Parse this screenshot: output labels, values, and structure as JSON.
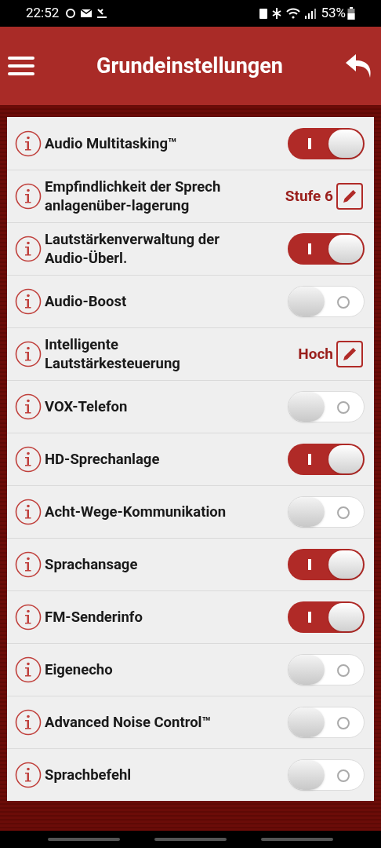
{
  "status_bar": {
    "time": "22:52",
    "battery": "53%"
  },
  "header": {
    "title": "Grundeinstellungen"
  },
  "rows": [
    {
      "kind": "toggle",
      "label": "Audio Multitasking™",
      "on": true
    },
    {
      "kind": "value",
      "label": "Empfindlichkeit der Sprech anlagenüber-lagerung",
      "value": "Stufe 6"
    },
    {
      "kind": "toggle",
      "label": "Lautstärkenverwaltung der Audio-Überl.",
      "on": true
    },
    {
      "kind": "toggle",
      "label": "Audio-Boost",
      "on": false
    },
    {
      "kind": "value",
      "label": "Intelligente Lautstärkesteuerung",
      "value": "Hoch"
    },
    {
      "kind": "toggle",
      "label": "VOX-Telefon",
      "on": false
    },
    {
      "kind": "toggle",
      "label": "HD-Sprechanlage",
      "on": true
    },
    {
      "kind": "toggle",
      "label": "Acht-Wege-Kommunikation",
      "on": false
    },
    {
      "kind": "toggle",
      "label": "Sprachansage",
      "on": true
    },
    {
      "kind": "toggle",
      "label": "FM-Senderinfo",
      "on": true
    },
    {
      "kind": "toggle",
      "label": "Eigenecho",
      "on": false
    },
    {
      "kind": "toggle",
      "label": "Advanced Noise Control™",
      "on": false
    },
    {
      "kind": "toggle",
      "label": "Sprachbefehl",
      "on": false
    }
  ]
}
